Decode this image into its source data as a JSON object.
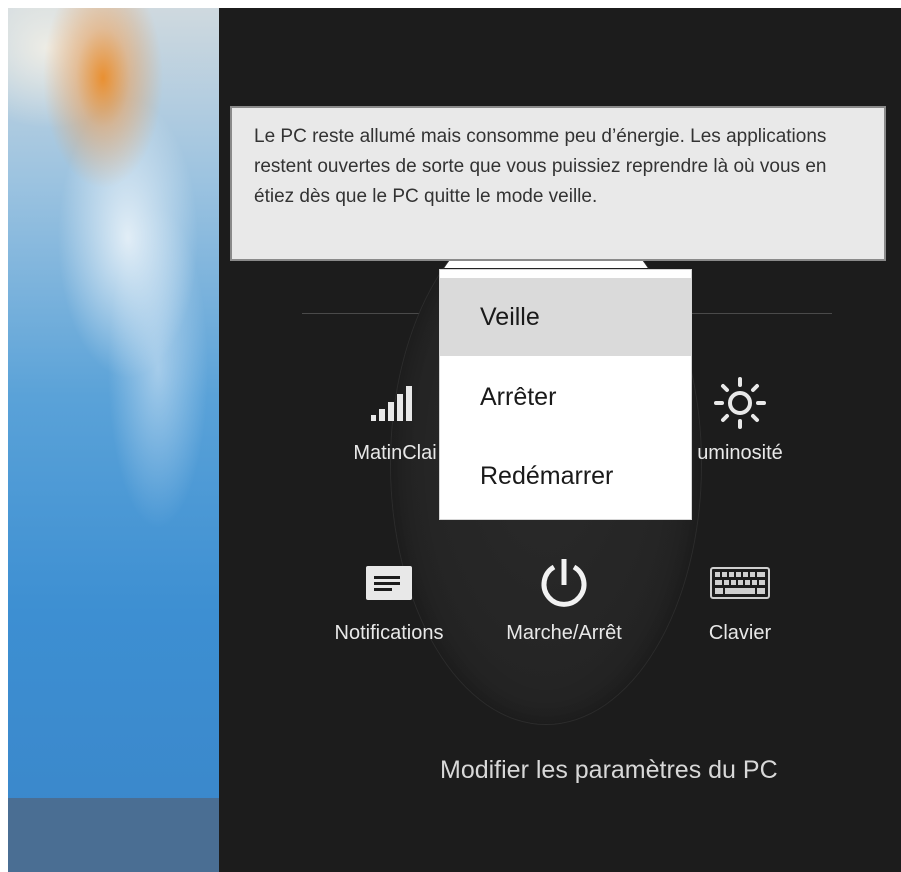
{
  "tooltip": {
    "text": "Le PC reste allumé mais consomme peu d’énergie. Les applications restent ouvertes de sorte que vous puissiez reprendre là où vous en étiez dès que le PC quitte le mode veille."
  },
  "power_menu": {
    "items": [
      {
        "label": "Veille",
        "selected": true
      },
      {
        "label": "Arrêter",
        "selected": false
      },
      {
        "label": "Redémarrer",
        "selected": false
      }
    ]
  },
  "tiles": {
    "network": {
      "label": "MatinClai",
      "icon": "signal-bars-icon"
    },
    "brightness": {
      "label": "uminosité",
      "icon": "brightness-sun-icon"
    },
    "notifications": {
      "label": "Notifications",
      "icon": "notifications-icon"
    },
    "power": {
      "label": "Marche/Arrêt",
      "icon": "power-icon"
    },
    "keyboard": {
      "label": "Clavier",
      "icon": "keyboard-icon"
    }
  },
  "footer": {
    "settings_link": "Modifier les paramètres du PC"
  },
  "colors": {
    "panel_bg": "#1c1c1c",
    "tooltip_bg": "#e9e9e9",
    "menu_selected_bg": "#dadada"
  }
}
